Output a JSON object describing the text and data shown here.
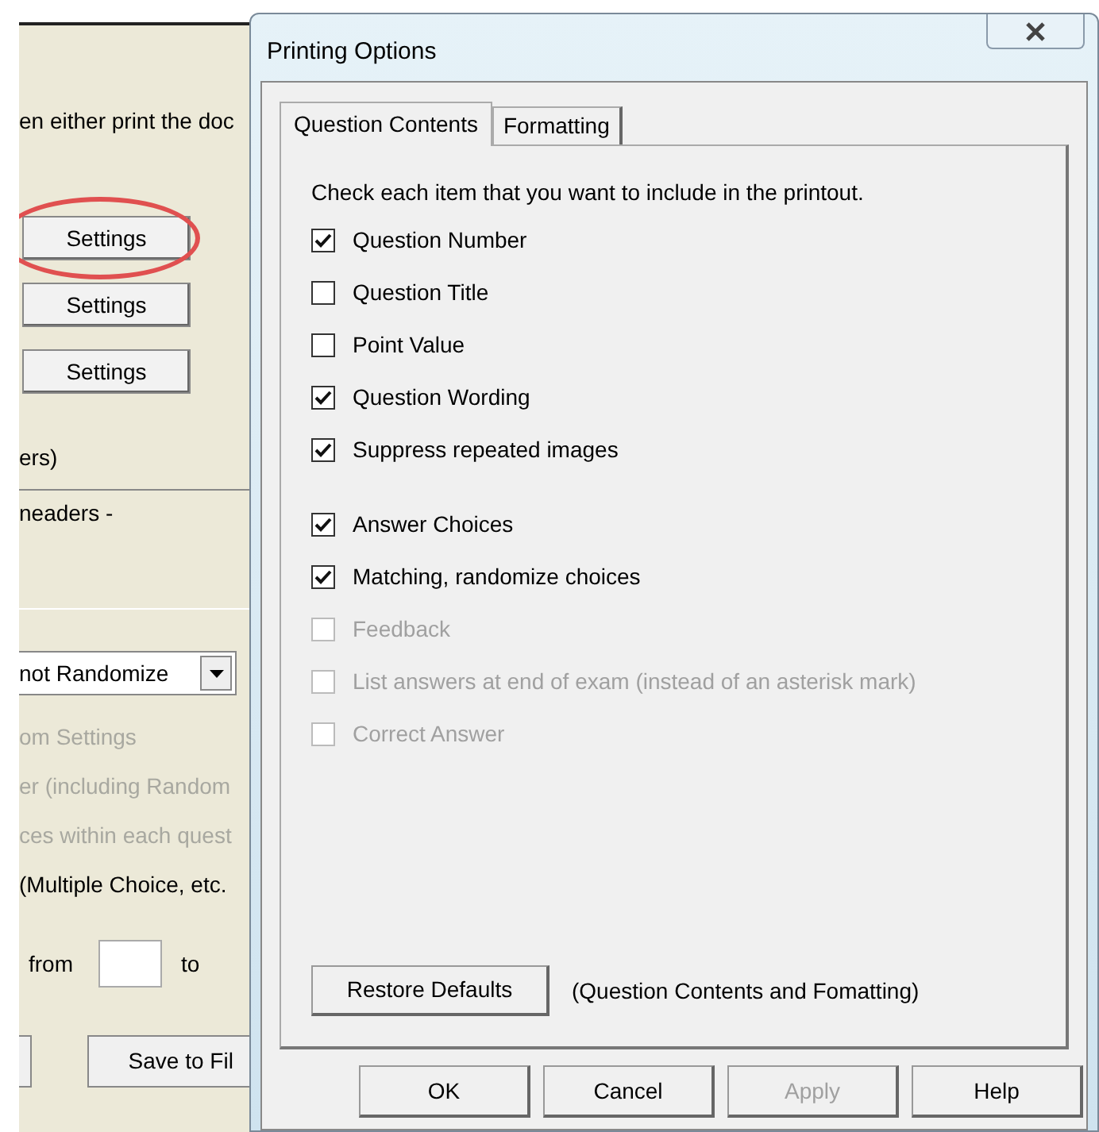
{
  "background_window": {
    "intro_text": "en either print the doc",
    "settings_buttons": [
      {
        "label": "Settings",
        "circled": true
      },
      {
        "label": "Settings",
        "circled": false
      },
      {
        "label": "Settings",
        "circled": false
      }
    ],
    "text_1": "ers)",
    "text_2": "neaders -",
    "order_dropdown": {
      "value": "not Randomize"
    },
    "options": [
      {
        "label": "om Settings",
        "disabled": true
      },
      {
        "label": "er (including Random",
        "disabled": true
      },
      {
        "label": "ces within each quest",
        "disabled": true
      },
      {
        "label": "(Multiple Choice, etc.",
        "disabled": false
      }
    ],
    "range": {
      "from_label": "from",
      "to_label": "to"
    },
    "save_button": "Save to Fil"
  },
  "dialog": {
    "title": "Printing Options",
    "tabs": [
      {
        "label": "Question Contents",
        "selected": true
      },
      {
        "label": "Formatting",
        "selected": false
      }
    ],
    "instruction": "Check each item that you want to include in the printout.",
    "option_groups": [
      {
        "options": [
          {
            "label": "Question Number",
            "checked": true,
            "disabled": false
          },
          {
            "label": "Question Title",
            "checked": false,
            "disabled": false
          },
          {
            "label": "Point Value",
            "checked": false,
            "disabled": false
          },
          {
            "label": "Question Wording",
            "checked": true,
            "disabled": false
          },
          {
            "label": "Suppress repeated images",
            "checked": true,
            "disabled": false
          }
        ]
      },
      {
        "options": [
          {
            "label": "Answer Choices",
            "checked": true,
            "disabled": false
          },
          {
            "label": "Matching, randomize choices",
            "checked": true,
            "disabled": false
          },
          {
            "label": "Feedback",
            "checked": false,
            "disabled": true
          },
          {
            "label": "List answers at end of exam (instead of an asterisk mark)",
            "checked": false,
            "disabled": true
          },
          {
            "label": "Correct Answer",
            "checked": false,
            "disabled": true
          }
        ]
      }
    ],
    "restore_button": "Restore Defaults",
    "restore_note": "(Question Contents and Fomatting)",
    "buttons": [
      {
        "label": "OK",
        "disabled": false
      },
      {
        "label": "Cancel",
        "disabled": false
      },
      {
        "label": "Apply",
        "disabled": true
      },
      {
        "label": "Help",
        "disabled": false
      }
    ]
  }
}
